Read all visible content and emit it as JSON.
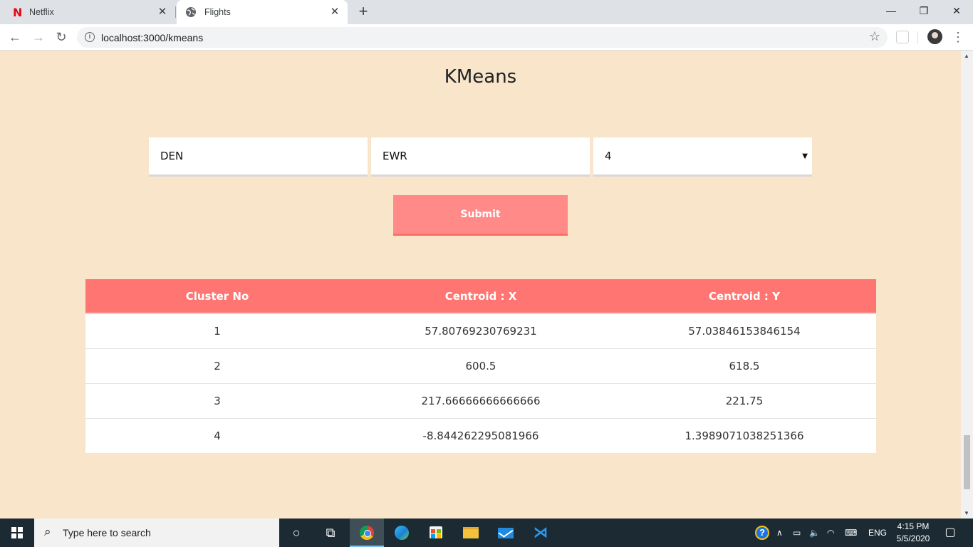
{
  "browser": {
    "tabs": [
      {
        "title": "Netflix",
        "icon": "netflix-logo-icon"
      },
      {
        "title": "Flights",
        "icon": "globe-icon"
      }
    ],
    "url": "localhost:3000/kmeans"
  },
  "page": {
    "title": "KMeans",
    "form": {
      "origin_value": "DEN",
      "destination_value": "EWR",
      "k_value": "4",
      "submit_label": "Submit"
    },
    "table": {
      "headers": [
        "Cluster No",
        "Centroid : X",
        "Centroid : Y"
      ],
      "rows": [
        [
          "1",
          "57.80769230769231",
          "57.03846153846154"
        ],
        [
          "2",
          "600.5",
          "618.5"
        ],
        [
          "3",
          "217.66666666666666",
          "221.75"
        ],
        [
          "4",
          "-8.844262295081966",
          "1.3989071038251366"
        ]
      ]
    }
  },
  "taskbar": {
    "search_placeholder": "Type here to search",
    "language": "ENG",
    "time": "4:15 PM",
    "date": "5/5/2020"
  },
  "colors": {
    "page_background": "#f8e5ca",
    "accent": "#fe7572",
    "button": "#ff8a87"
  }
}
